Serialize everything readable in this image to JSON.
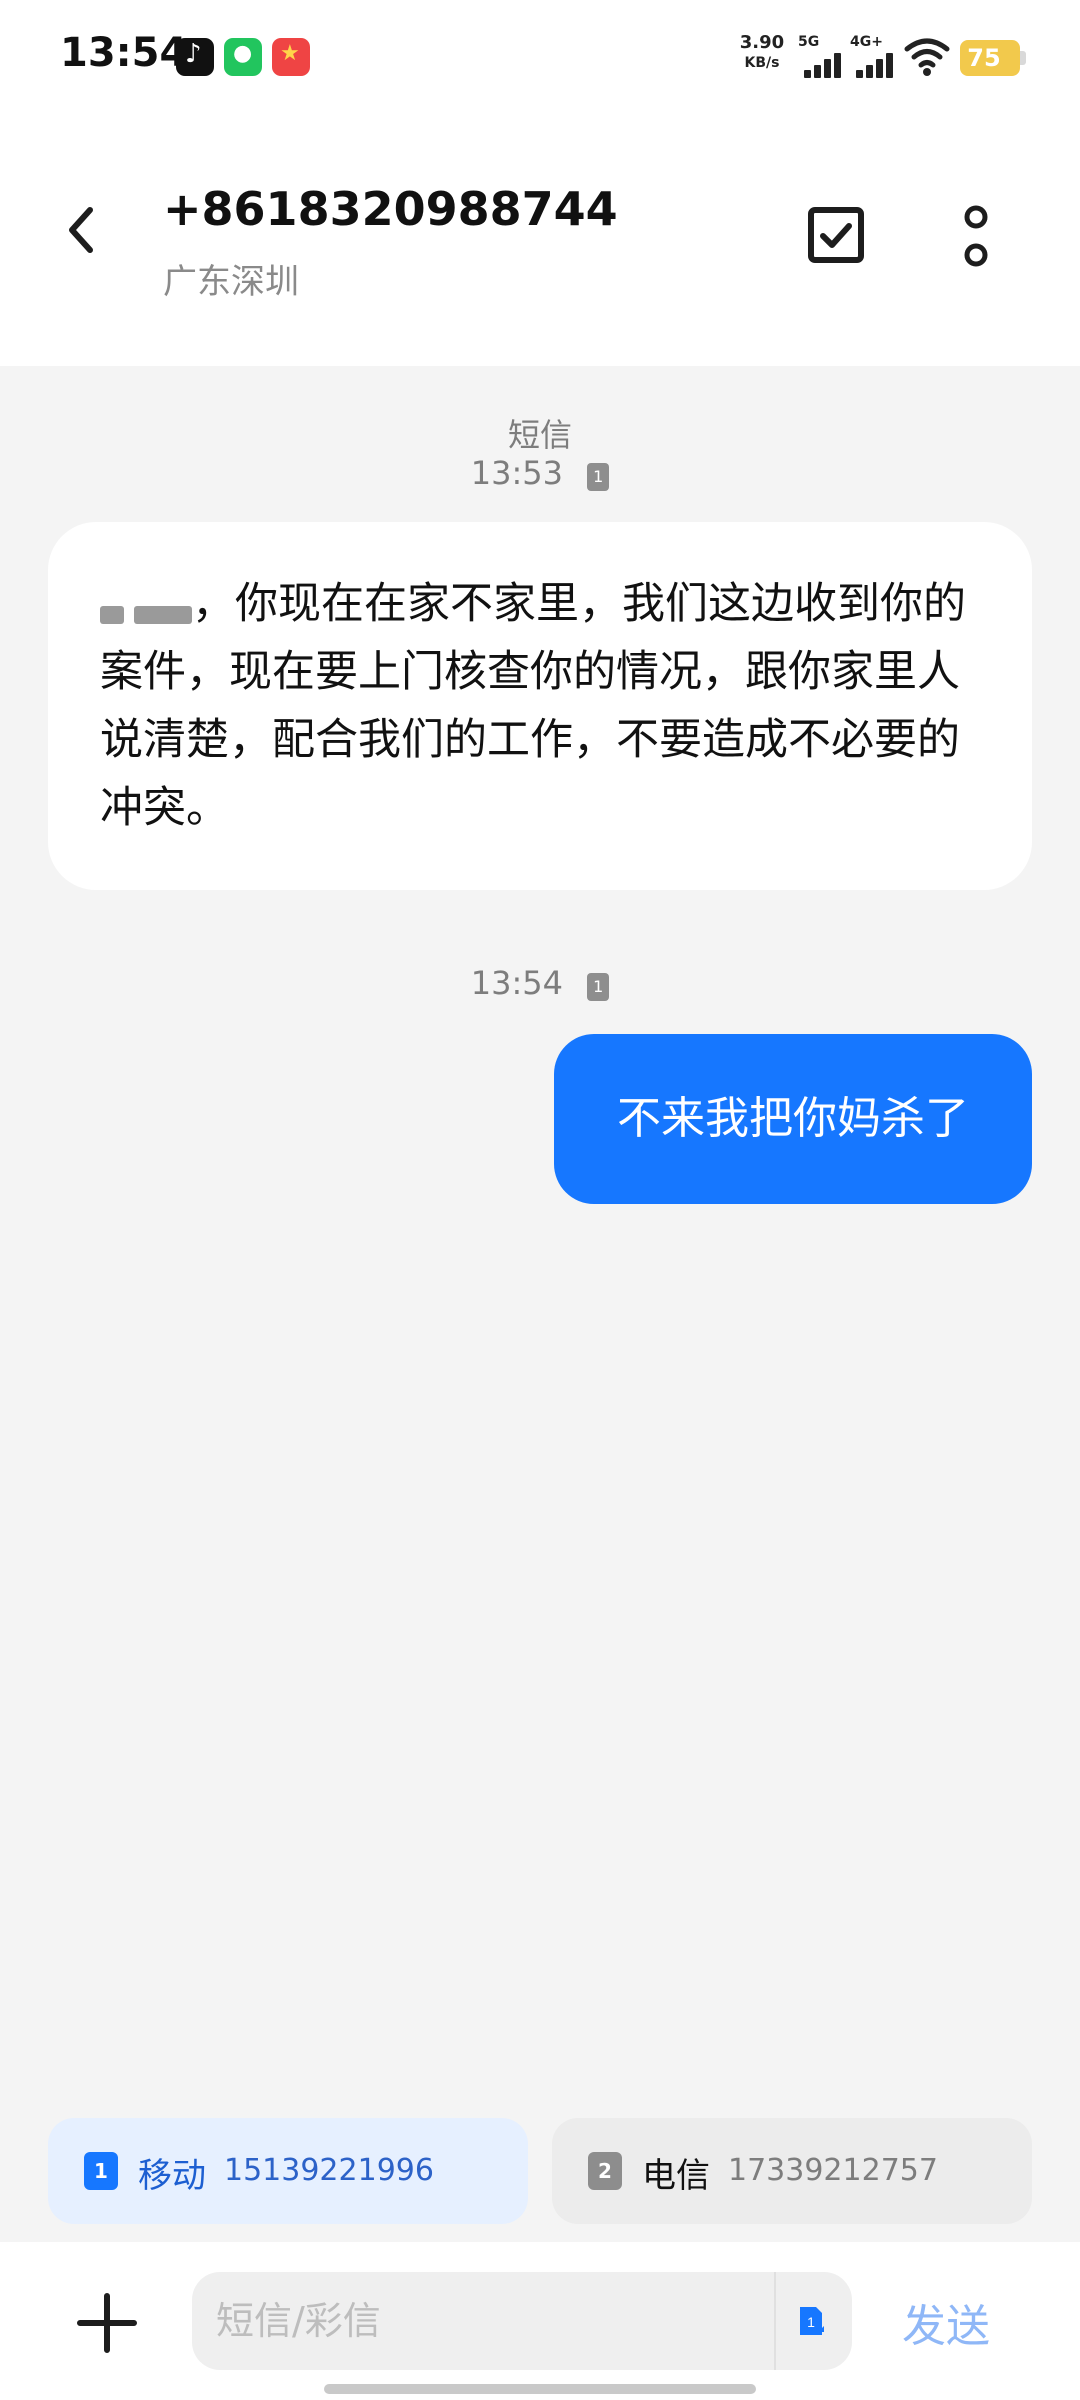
{
  "status_bar": {
    "time": "13:54",
    "network_speed_value": "3.90",
    "network_speed_unit": "KB/s",
    "signal_5g_label": "5G",
    "signal_4g_label": "4G+",
    "battery_level": "75",
    "icons": {
      "douyin": "douyin-icon",
      "wechat": "wechat-icon",
      "game": "game-icon",
      "wifi": "wifi-icon"
    }
  },
  "header": {
    "title": "+8618320988744",
    "subtitle": "广东深圳",
    "back_icon": "chevron-left-icon",
    "select_icon": "checkbox-icon",
    "more_icon": "more-vertical-icon"
  },
  "conversation": {
    "message_type": "短信",
    "timestamp_1": "13:53",
    "timestamp_2": "13:54",
    "sim_indicator": "1",
    "incoming_message": "，你现在在家不家里，我们这边收到你的案件，现在要上门核查你的情况，跟你家里人说清楚，配合我们的工作，不要造成不必要的冲突。",
    "outgoing_message": "不来我把你妈杀了"
  },
  "sim_selector": {
    "options": [
      {
        "badge": "1",
        "name": "移动",
        "number": "15139221996",
        "active": true
      },
      {
        "badge": "2",
        "name": "电信",
        "number": "17339212757",
        "active": false
      }
    ]
  },
  "composer": {
    "plus_icon": "plus-icon",
    "placeholder": "短信/彩信",
    "value": "",
    "sim_switch_icon": "sim-switch-icon",
    "send_label": "发送"
  },
  "colors": {
    "accent_blue": "#1677ff",
    "light_blue_bg": "#e6f0ff",
    "chat_bg": "#f4f4f4",
    "battery_yellow": "#f2c94c"
  }
}
